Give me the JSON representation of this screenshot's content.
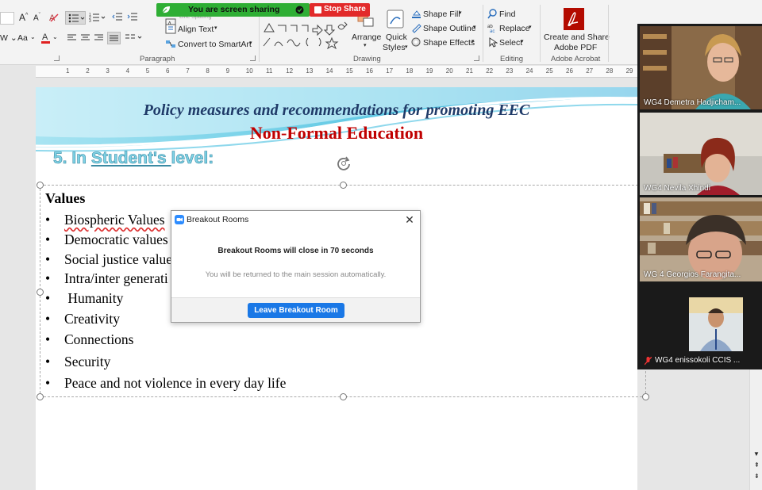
{
  "ribbon": {
    "font_size_value": "Aa",
    "shortcuts": {
      "line_spacing_label": "Line Spacing"
    },
    "align_text_label": "Align Text",
    "convert_smartart_label": "Convert to SmartArt",
    "paragraph_group": "Paragraph",
    "drawing_group": "Drawing",
    "arrange_label": "Arrange",
    "quick_styles_label_1": "Quick",
    "quick_styles_label_2": "Styles",
    "shape_fill_label": "Shape Fill",
    "shape_outline_label": "Shape Outline",
    "shape_effects_label": "Shape Effects",
    "find_label": "Find",
    "replace_label": "Replace",
    "select_label": "Select",
    "editing_group": "Editing",
    "acrobat_label_1": "Create and Share",
    "acrobat_label_2": "Adobe PDF",
    "acrobat_group": "Adobe Acrobat"
  },
  "share": {
    "banner_text": "You are screen sharing",
    "stop_label": "Stop Share"
  },
  "ruler": {
    "numbers": [
      "1",
      "2",
      "3",
      "4",
      "5",
      "6",
      "7",
      "8",
      "9",
      "10",
      "11",
      "12",
      "13",
      "14",
      "15",
      "16",
      "17",
      "18",
      "19",
      "20",
      "21",
      "22",
      "23",
      "24",
      "25",
      "26",
      "27",
      "28",
      "29"
    ]
  },
  "slide": {
    "title": "Policy measures and recommendations for promoting EEC",
    "subtitle": "Non-Formal Education",
    "level_prefix": "5. In ",
    "level_underlined": "Student's ",
    "level_suffix": "level:",
    "values_heading": "Values",
    "bullets": [
      "Biospheric Values",
      "Democratic values",
      "Social justice value",
      "Intra/inter generati",
      " Humanity",
      "Creativity",
      "Connections",
      "Security",
      "Peace and not violence in every day life"
    ],
    "bullet_char": "•"
  },
  "participants": [
    {
      "name": "WG4 Demetra Hadjicham..."
    },
    {
      "name": "WG4 Nevila Xhindi"
    },
    {
      "name": "WG 4 Georgios Farangita..."
    },
    {
      "name": "WG4 enissokoli CCIS ..."
    }
  ],
  "dialog": {
    "title": "Breakout Rooms",
    "message": "Breakout Rooms will close in 70 seconds",
    "submessage": "You will be returned to the main session automatically.",
    "leave_label": "Leave Breakout Room"
  },
  "colors": {
    "share_green": "#2eae34",
    "stop_red": "#e22a2a",
    "title_navy": "#1f3a68",
    "subtitle_red": "#c00000",
    "heading_cyan": "#7fd3e6",
    "leave_blue": "#1a78e6"
  }
}
